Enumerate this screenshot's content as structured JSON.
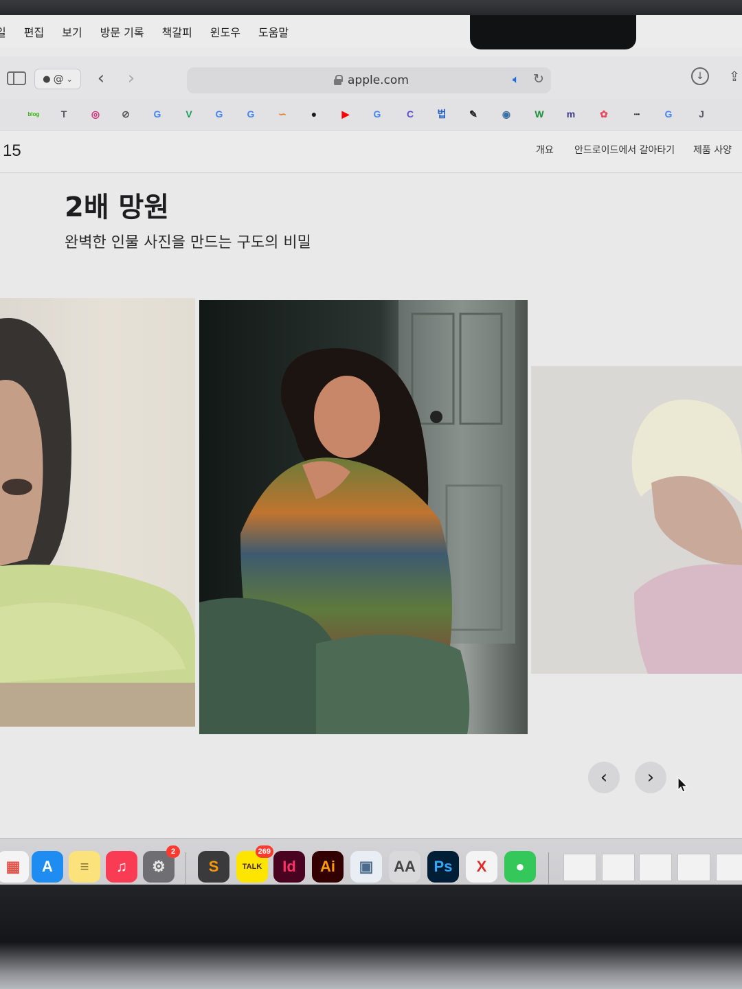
{
  "menubar": {
    "items": [
      "일",
      "편집",
      "보기",
      "방문 기록",
      "책갈피",
      "윈도우",
      "도움말"
    ]
  },
  "toolbar": {
    "profile_label": "@",
    "url": "apple.com"
  },
  "favorites": [
    {
      "icon": "naver-blog-icon",
      "glyph": "blog",
      "color": "#2db400"
    },
    {
      "icon": "t-icon",
      "glyph": "T",
      "color": "#5a5a5e"
    },
    {
      "icon": "instagram-icon",
      "glyph": "◎",
      "color": "#d62976"
    },
    {
      "icon": "compass-icon",
      "glyph": "⊘",
      "color": "#555555"
    },
    {
      "icon": "google-icon",
      "glyph": "G",
      "color": "#4285f4"
    },
    {
      "icon": "v-icon",
      "glyph": "V",
      "color": "#1a9e5c"
    },
    {
      "icon": "google-icon",
      "glyph": "G",
      "color": "#4285f4"
    },
    {
      "icon": "google-icon",
      "glyph": "G",
      "color": "#4285f4"
    },
    {
      "icon": "swirl-icon",
      "glyph": "∽",
      "color": "#e67e22"
    },
    {
      "icon": "dark-circle-icon",
      "glyph": "●",
      "color": "#1a1a1a"
    },
    {
      "icon": "youtube-icon",
      "glyph": "▶",
      "color": "#ff0000"
    },
    {
      "icon": "google-icon",
      "glyph": "G",
      "color": "#4285f4"
    },
    {
      "icon": "c-icon",
      "glyph": "C",
      "color": "#5b4bd6"
    },
    {
      "icon": "dictionary-icon",
      "glyph": "법",
      "color": "#1f5fbf"
    },
    {
      "icon": "pen-icon",
      "glyph": "✎",
      "color": "#1a1a1a"
    },
    {
      "icon": "globe-icon",
      "glyph": "◉",
      "color": "#3a6ea5"
    },
    {
      "icon": "w-icon",
      "glyph": "W",
      "color": "#1a8f3c"
    },
    {
      "icon": "m-icon",
      "glyph": "m",
      "color": "#3d3a8c"
    },
    {
      "icon": "color-wheel-icon",
      "glyph": "✿",
      "color": "#e84a5f"
    },
    {
      "icon": "dots-icon",
      "glyph": "•••",
      "color": "#1a1a1a"
    },
    {
      "icon": "google-icon",
      "glyph": "G",
      "color": "#4285f4"
    },
    {
      "icon": "j-icon",
      "glyph": "J",
      "color": "#5a5a5e"
    }
  ],
  "localnav": {
    "product": "15",
    "links": [
      "개요",
      "안드로이드에서 갈아타기",
      "제품 사양"
    ]
  },
  "hero": {
    "headline": "2배 망원",
    "subhead": "완벽한 인물 사진을 만드는 구도의 비밀"
  },
  "carousel": {
    "prev_glyph": "‹",
    "next_glyph": "›"
  },
  "dock": {
    "apps": [
      {
        "icon": "launchpad-icon",
        "glyph": "▦",
        "bg": "#f4f4f4",
        "fg": "#e0534a"
      },
      {
        "icon": "app-store-icon",
        "glyph": "A",
        "bg": "#1e8cf0",
        "fg": "#ffffff"
      },
      {
        "icon": "notes-icon",
        "glyph": "≡",
        "bg": "#fbe27a",
        "fg": "#8a7a3a"
      },
      {
        "icon": "music-icon",
        "glyph": "♫",
        "bg": "#fa3b54",
        "fg": "#ffffff"
      },
      {
        "icon": "system-settings-icon",
        "glyph": "⚙",
        "bg": "#6e6e73",
        "fg": "#e8e8e8",
        "badge": "2"
      },
      {
        "icon": "sublime-text-icon",
        "glyph": "S",
        "bg": "#3a3a3c",
        "fg": "#ff9800"
      },
      {
        "icon": "kakaotalk-icon",
        "glyph": "TALK",
        "bg": "#fee500",
        "fg": "#3c1e1e",
        "badge": "269"
      },
      {
        "icon": "indesign-icon",
        "glyph": "Id",
        "bg": "#49021f",
        "fg": "#ff3366"
      },
      {
        "icon": "illustrator-icon",
        "glyph": "Ai",
        "bg": "#330000",
        "fg": "#ff9a00"
      },
      {
        "icon": "preview-icon",
        "glyph": "▣",
        "bg": "#e8eef4",
        "fg": "#4a6b8a"
      },
      {
        "icon": "font-book-icon",
        "glyph": "AA",
        "bg": "#d9d9db",
        "fg": "#444444"
      },
      {
        "icon": "photoshop-icon",
        "glyph": "Ps",
        "bg": "#001e36",
        "fg": "#31a8ff"
      },
      {
        "icon": "learning-x-icon",
        "glyph": "X",
        "bg": "#f4f4f4",
        "fg": "#e02b2b"
      },
      {
        "icon": "messages-icon",
        "glyph": "●",
        "bg": "#34c759",
        "fg": "#ffffff"
      }
    ]
  }
}
